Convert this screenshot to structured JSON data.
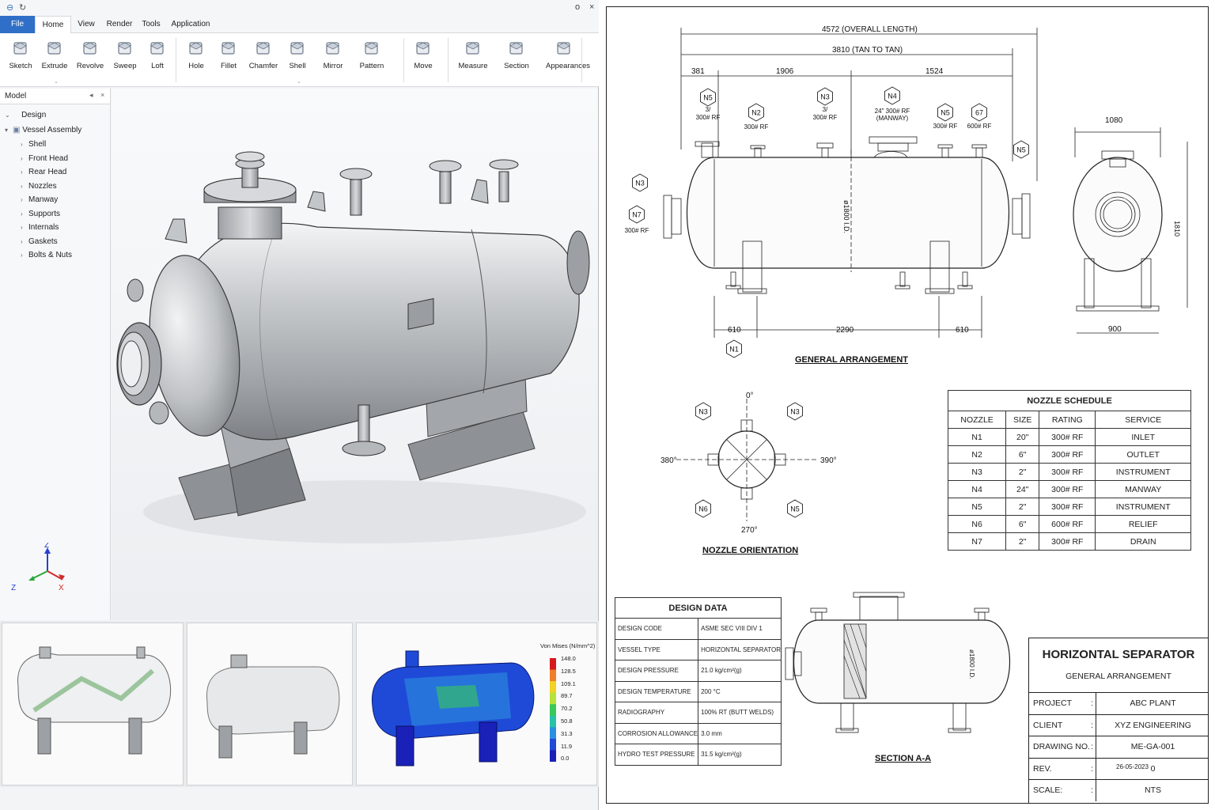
{
  "app": {
    "title_icons": [
      "quick-access-logo-icon",
      "quick-access-redo-icon"
    ],
    "window_controls": [
      "o",
      "□",
      "×"
    ]
  },
  "menu": {
    "tabs": [
      {
        "label": "File"
      },
      {
        "label": "Home"
      },
      {
        "label": "View"
      },
      {
        "label": "Render"
      },
      {
        "label": "Tools"
      },
      {
        "label": "Application"
      }
    ],
    "active": "Home"
  },
  "ribbon": {
    "buttons": [
      {
        "label": "Sketch",
        "icon": "sketch-icon"
      },
      {
        "label": "Extrude",
        "icon": "extrude-icon"
      },
      {
        "label": "Revolve",
        "icon": "revolve-icon"
      },
      {
        "label": "Sweep",
        "icon": "sweep-icon"
      },
      {
        "label": "Loft",
        "icon": "loft-icon"
      },
      {
        "label": "Hole",
        "icon": "hole-icon"
      },
      {
        "label": "Fillet",
        "icon": "fillet-icon"
      },
      {
        "label": "Chamfer",
        "icon": "chamfer-icon"
      },
      {
        "label": "Shell",
        "icon": "shell-icon"
      },
      {
        "label": "Mirror",
        "icon": "mirror-icon"
      },
      {
        "label": "Pattern",
        "icon": "pattern-icon"
      },
      {
        "label": "Move",
        "icon": "move-icon"
      },
      {
        "label": "Measure",
        "icon": "measure-icon"
      },
      {
        "label": "Section",
        "icon": "section-icon"
      },
      {
        "label": "Appearances",
        "icon": "appearances-icon"
      }
    ]
  },
  "model_panel": {
    "title": "Model",
    "root": "Design",
    "assembly": "Vessel Assembly",
    "items": [
      "Shell",
      "Front Head",
      "Rear Head",
      "Nozzles",
      "Manway",
      "Supports",
      "Internals",
      "Gaskets",
      "Bolts & Nuts"
    ]
  },
  "triad": {
    "z": "Z",
    "x": "X",
    "z2": "Z"
  },
  "fea_legend": {
    "title": "Von Mises (N/mm^2)",
    "values": [
      "148.0",
      "128.5",
      "109.1",
      "89.7",
      "70.2",
      "50.8",
      "31.3",
      "11.9",
      "0.0"
    ],
    "colors": [
      "#d7191c",
      "#f07d2a",
      "#f2d321",
      "#b8e23a",
      "#39c85a",
      "#27c2a8",
      "#2b8fe0",
      "#1f4ad8",
      "#1a21b8"
    ]
  },
  "drawing": {
    "dims": {
      "overall": "4572 (OVERALL LENGTH)",
      "tan": "3810 (TAN TO TAN)",
      "d381": "381",
      "d1906": "1906",
      "d1524": "1524",
      "d610a": "610",
      "d2290": "2290",
      "d610b": "610",
      "d1080": "1080",
      "d900": "900",
      "shell_id": "ø1800 I.D.",
      "height": "1810",
      "sec_id": "ø1800 I.D."
    },
    "tags": {
      "n5a": "N5",
      "n5a_spec1": "3/",
      "n5a_spec2": "300# RF",
      "n2": "N2",
      "n2_spec": "300# RF",
      "n3t": "N3",
      "n3t_spec1": "3/",
      "n3t_spec2": "300# RF",
      "n4": "N4",
      "n4_spec1": "24\"  300# RF",
      "n4_spec2": "(MANWAY)",
      "n5b": "N5",
      "n5b_spec": "300# RF",
      "n67": "67",
      "n67_spec": "600# RF",
      "n5c": "N5",
      "n3l": "N3",
      "n7": "N7",
      "n7_spec": "300# RF",
      "n1": "N1"
    },
    "ga_title": "GENERAL ARRANGEMENT",
    "orientation": {
      "title": "NOZZLE ORIENTATION",
      "deg0": "0°",
      "deg90": "390°",
      "deg180": "380°",
      "deg270": "270°",
      "tl": "N3",
      "tr": "N3",
      "bl": "N6",
      "br": "N5"
    },
    "section_title": "SECTION A-A"
  },
  "nozzle_schedule": {
    "title": "NOZZLE SCHEDULE",
    "headers": [
      "NOZZLE",
      "SIZE",
      "RATING",
      "SERVICE"
    ],
    "rows": [
      [
        "N1",
        "20\"",
        "300# RF",
        "INLET"
      ],
      [
        "N2",
        "6\"",
        "300# RF",
        "OUTLET"
      ],
      [
        "N3",
        "2\"",
        "300# RF",
        "INSTRUMENT"
      ],
      [
        "N4",
        "24\"",
        "300# RF",
        "MANWAY"
      ],
      [
        "N5",
        "2\"",
        "300# RF",
        "INSTRUMENT"
      ],
      [
        "N6",
        "6\"",
        "600# RF",
        "RELIEF"
      ],
      [
        "N7",
        "2\"",
        "300# RF",
        "DRAIN"
      ]
    ]
  },
  "design_data": {
    "title": "DESIGN DATA",
    "rows": [
      [
        "DESIGN CODE",
        "ASME SEC VIII DIV 1"
      ],
      [
        "VESSEL TYPE",
        "HORIZONTAL SEPARATOR"
      ],
      [
        "DESIGN PRESSURE",
        "21.0  kg/cm²(g)"
      ],
      [
        "DESIGN TEMPERATURE",
        "200  °C"
      ],
      [
        "RADIOGRAPHY",
        "100% RT (BUTT WELDS)"
      ],
      [
        "CORROSION ALLOWANCE",
        "3.0  mm"
      ],
      [
        "HYDRO TEST PRESSURE",
        "31.5  kg/cm²(g)"
      ]
    ]
  },
  "title_block": {
    "title": "HORIZONTAL SEPARATOR",
    "subtitle": "GENERAL ARRANGEMENT",
    "rows": [
      {
        "k": "PROJECT",
        "v": "ABC PLANT"
      },
      {
        "k": "CLIENT",
        "v": "XYZ ENGINEERING"
      },
      {
        "k": "DRAWING NO.",
        "v": "ME-GA-001"
      },
      {
        "k": "REV.",
        "v": "0"
      },
      {
        "k": "SCALE:",
        "v": "NTS"
      }
    ],
    "rev_date": "26-05-2023"
  }
}
